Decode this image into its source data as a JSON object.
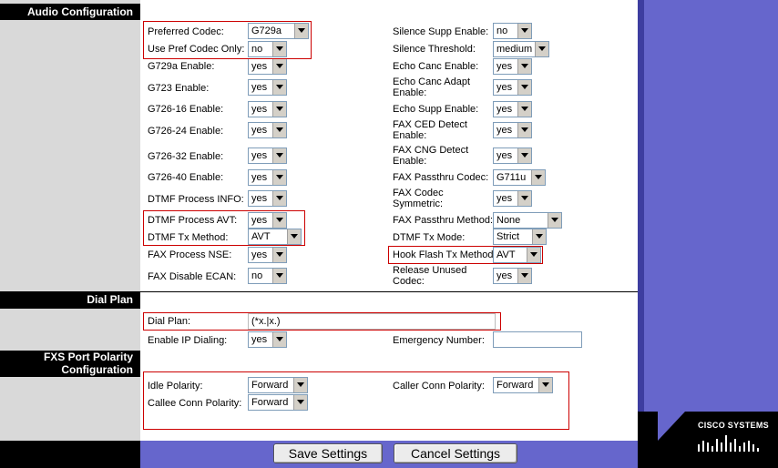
{
  "sections": {
    "audio": "Audio Configuration",
    "dial_plan": "Dial Plan",
    "fxs_line1": "FXS Port Polarity",
    "fxs_line2": "Configuration"
  },
  "left_fields": [
    {
      "label": "Preferred Codec:",
      "value": "G729a"
    },
    {
      "label": "Use Pref Codec Only:",
      "value": "no"
    },
    {
      "label": "G729a Enable:",
      "value": "yes"
    },
    {
      "label": "G723 Enable:",
      "value": "yes"
    },
    {
      "label": "G726-16 Enable:",
      "value": "yes"
    },
    {
      "label": "G726-24 Enable:",
      "value": "yes"
    },
    {
      "label": "G726-32 Enable:",
      "value": "yes"
    },
    {
      "label": "G726-40 Enable:",
      "value": "yes"
    },
    {
      "label": "DTMF Process INFO:",
      "value": "yes"
    },
    {
      "label": "DTMF Process AVT:",
      "value": "yes"
    },
    {
      "label": "DTMF Tx Method:",
      "value": "AVT"
    },
    {
      "label": "FAX Process NSE:",
      "value": "yes"
    },
    {
      "label": "FAX Disable ECAN:",
      "value": "no"
    }
  ],
  "right_fields": [
    {
      "label": "Silence Supp Enable:",
      "value": "no"
    },
    {
      "label": "Silence Threshold:",
      "value": "medium"
    },
    {
      "label": "Echo Canc Enable:",
      "value": "yes"
    },
    {
      "label": "Echo Canc Adapt Enable:",
      "value": "yes"
    },
    {
      "label": "Echo Supp Enable:",
      "value": "yes"
    },
    {
      "label": "FAX CED Detect Enable:",
      "value": "yes"
    },
    {
      "label": "FAX CNG Detect Enable:",
      "value": "yes"
    },
    {
      "label": "FAX Passthru Codec:",
      "value": "G711u"
    },
    {
      "label": "FAX Codec Symmetric:",
      "value": "yes"
    },
    {
      "label": "FAX Passthru Method:",
      "value": "None"
    },
    {
      "label": "DTMF Tx Mode:",
      "value": "Strict"
    },
    {
      "label": "Hook Flash Tx Method:",
      "value": "AVT"
    },
    {
      "label": "Release Unused Codec:",
      "value": "yes"
    }
  ],
  "dial": {
    "dial_plan_label": "Dial Plan:",
    "dial_plan_value": "(*x.|x.)",
    "ip_dialing_label": "Enable IP Dialing:",
    "ip_dialing_value": "yes",
    "emergency_label": "Emergency Number:",
    "emergency_value": ""
  },
  "polarity": {
    "idle_label": "Idle Polarity:",
    "idle_value": "Forward",
    "caller_label": "Caller Conn Polarity:",
    "caller_value": "Forward",
    "callee_label": "Callee Conn Polarity:",
    "callee_value": "Forward"
  },
  "buttons": {
    "save": "Save Settings",
    "cancel": "Cancel Settings"
  },
  "logo": "CISCO SYSTEMS",
  "colors": {
    "accent_purple": "#6666cc",
    "highlight_red": "#cc0000",
    "panel_gray": "#d9d9d9"
  }
}
